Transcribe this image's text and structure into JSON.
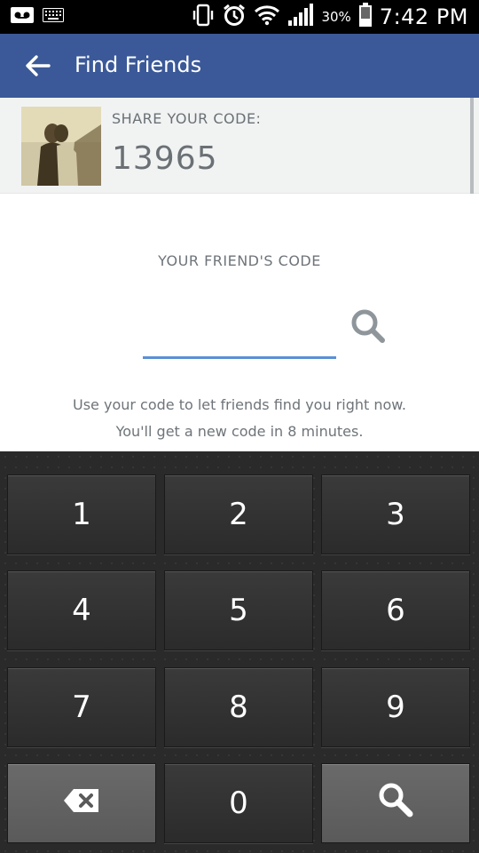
{
  "status_bar": {
    "battery_text": "30%",
    "time": "7:42 PM",
    "icons": [
      "voicemail-icon",
      "keyboard-icon",
      "vibrate-icon",
      "alarm-icon",
      "wifi-icon",
      "signal-icon",
      "battery-icon"
    ]
  },
  "app_bar": {
    "title": "Find Friends",
    "background": "#3b5998"
  },
  "share": {
    "label": "SHARE YOUR CODE:",
    "code": "13965"
  },
  "friend": {
    "label": "YOUR FRIEND'S CODE",
    "input_value": "",
    "help_line1": "Use your code to let friends find you right now.",
    "help_line2": "You'll get a new code in 8 minutes.",
    "accent": "#5b8fd6"
  },
  "keypad": {
    "keys": [
      "1",
      "2",
      "3",
      "4",
      "5",
      "6",
      "7",
      "8",
      "9",
      "0"
    ],
    "icons": [
      "backspace-icon",
      "search-icon"
    ]
  }
}
